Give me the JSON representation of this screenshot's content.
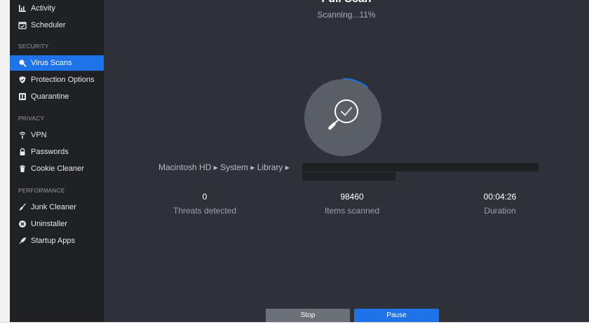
{
  "sidebar": {
    "top_items": [
      {
        "label": "Activity",
        "icon": "activity-icon"
      },
      {
        "label": "Scheduler",
        "icon": "calendar-icon"
      }
    ],
    "sections": [
      {
        "label": "SECURITY",
        "items": [
          {
            "label": "Virus Scans",
            "icon": "search-icon",
            "active": true
          },
          {
            "label": "Protection Options",
            "icon": "shield-icon"
          },
          {
            "label": "Quarantine",
            "icon": "quarantine-icon"
          }
        ]
      },
      {
        "label": "PRIVACY",
        "items": [
          {
            "label": "VPN",
            "icon": "vpn-icon"
          },
          {
            "label": "Passwords",
            "icon": "lock-icon"
          },
          {
            "label": "Cookie Cleaner",
            "icon": "trash-icon"
          }
        ]
      },
      {
        "label": "PERFORMANCE",
        "items": [
          {
            "label": "Junk Cleaner",
            "icon": "broom-icon"
          },
          {
            "label": "Uninstaller",
            "icon": "close-circle-icon"
          },
          {
            "label": "Startup Apps",
            "icon": "rocket-icon"
          }
        ]
      }
    ]
  },
  "scan": {
    "title": "Full Scan",
    "status": "Scanning...11%",
    "progress_percent": 11,
    "path": "Macintosh HD ▸ System ▸ Library ▸",
    "stats": [
      {
        "value": "0",
        "label": "Threats detected"
      },
      {
        "value": "98460",
        "label": "Items scanned"
      },
      {
        "value": "00:04:26",
        "label": "Duration"
      }
    ]
  },
  "buttons": {
    "stop": "Stop",
    "pause": "Pause"
  },
  "colors": {
    "accent": "#1e73e8",
    "sidebar_bg": "#1f2125",
    "main_bg": "#2e3238"
  }
}
